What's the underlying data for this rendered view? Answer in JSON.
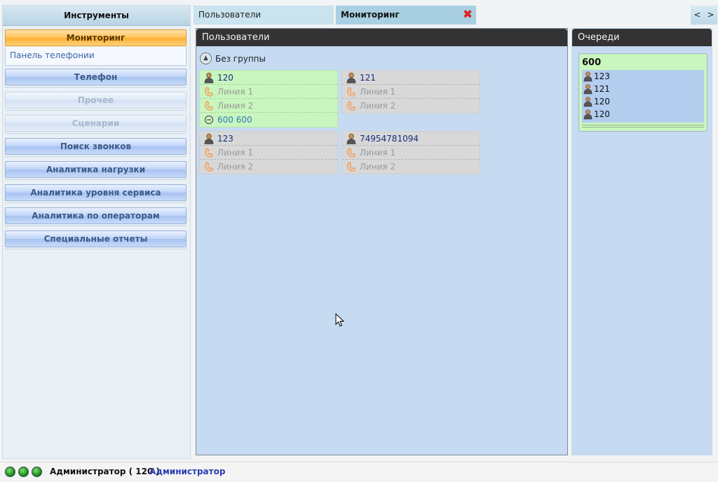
{
  "sidebar": {
    "title": "Инструменты",
    "active_item": "Мониторинг",
    "subitem": "Панель телефонии",
    "items": [
      {
        "label": "Телефон",
        "state": "normal"
      },
      {
        "label": "Прочее",
        "state": "disabled"
      },
      {
        "label": "Сценарии",
        "state": "disabled"
      },
      {
        "label": "Поиск звонков",
        "state": "normal"
      },
      {
        "label": "Аналитика нагрузки",
        "state": "normal"
      },
      {
        "label": "Аналитика уровня сервиса",
        "state": "normal"
      },
      {
        "label": "Аналитика по операторам",
        "state": "normal"
      },
      {
        "label": "Специальные отчеты",
        "state": "normal"
      }
    ]
  },
  "tabs": {
    "users": "Пользователи",
    "monitoring": "Мониторинг",
    "close_icon": "close-icon",
    "prev": "<",
    "next": ">"
  },
  "users_panel": {
    "title": "Пользователи",
    "group_label": "Без группы",
    "cards": [
      {
        "user": "120",
        "lines": [
          "Линия 1",
          "Линия 2"
        ],
        "queue": "600  600",
        "status": "green"
      },
      {
        "user": "121",
        "lines": [
          "Линия 1",
          "Линия 2"
        ],
        "status": "gray"
      },
      {
        "user": "123",
        "lines": [
          "Линия 1",
          "Линия 2"
        ],
        "status": "gray"
      },
      {
        "user": "74954781094",
        "lines": [
          "Линия 1",
          "Линия 2"
        ],
        "status": "gray"
      }
    ]
  },
  "queues_panel": {
    "title": "Очереди",
    "queue_name": "600",
    "members": [
      "123",
      "121",
      "120",
      "120"
    ]
  },
  "statusbar": {
    "user": "Администратор ( 120 )",
    "role": "Администратор"
  },
  "colors": {
    "accent_orange": "#ffad2e",
    "panel_blue": "#c6dbf2",
    "card_green": "#c9f5be",
    "header_dark": "#333333"
  }
}
